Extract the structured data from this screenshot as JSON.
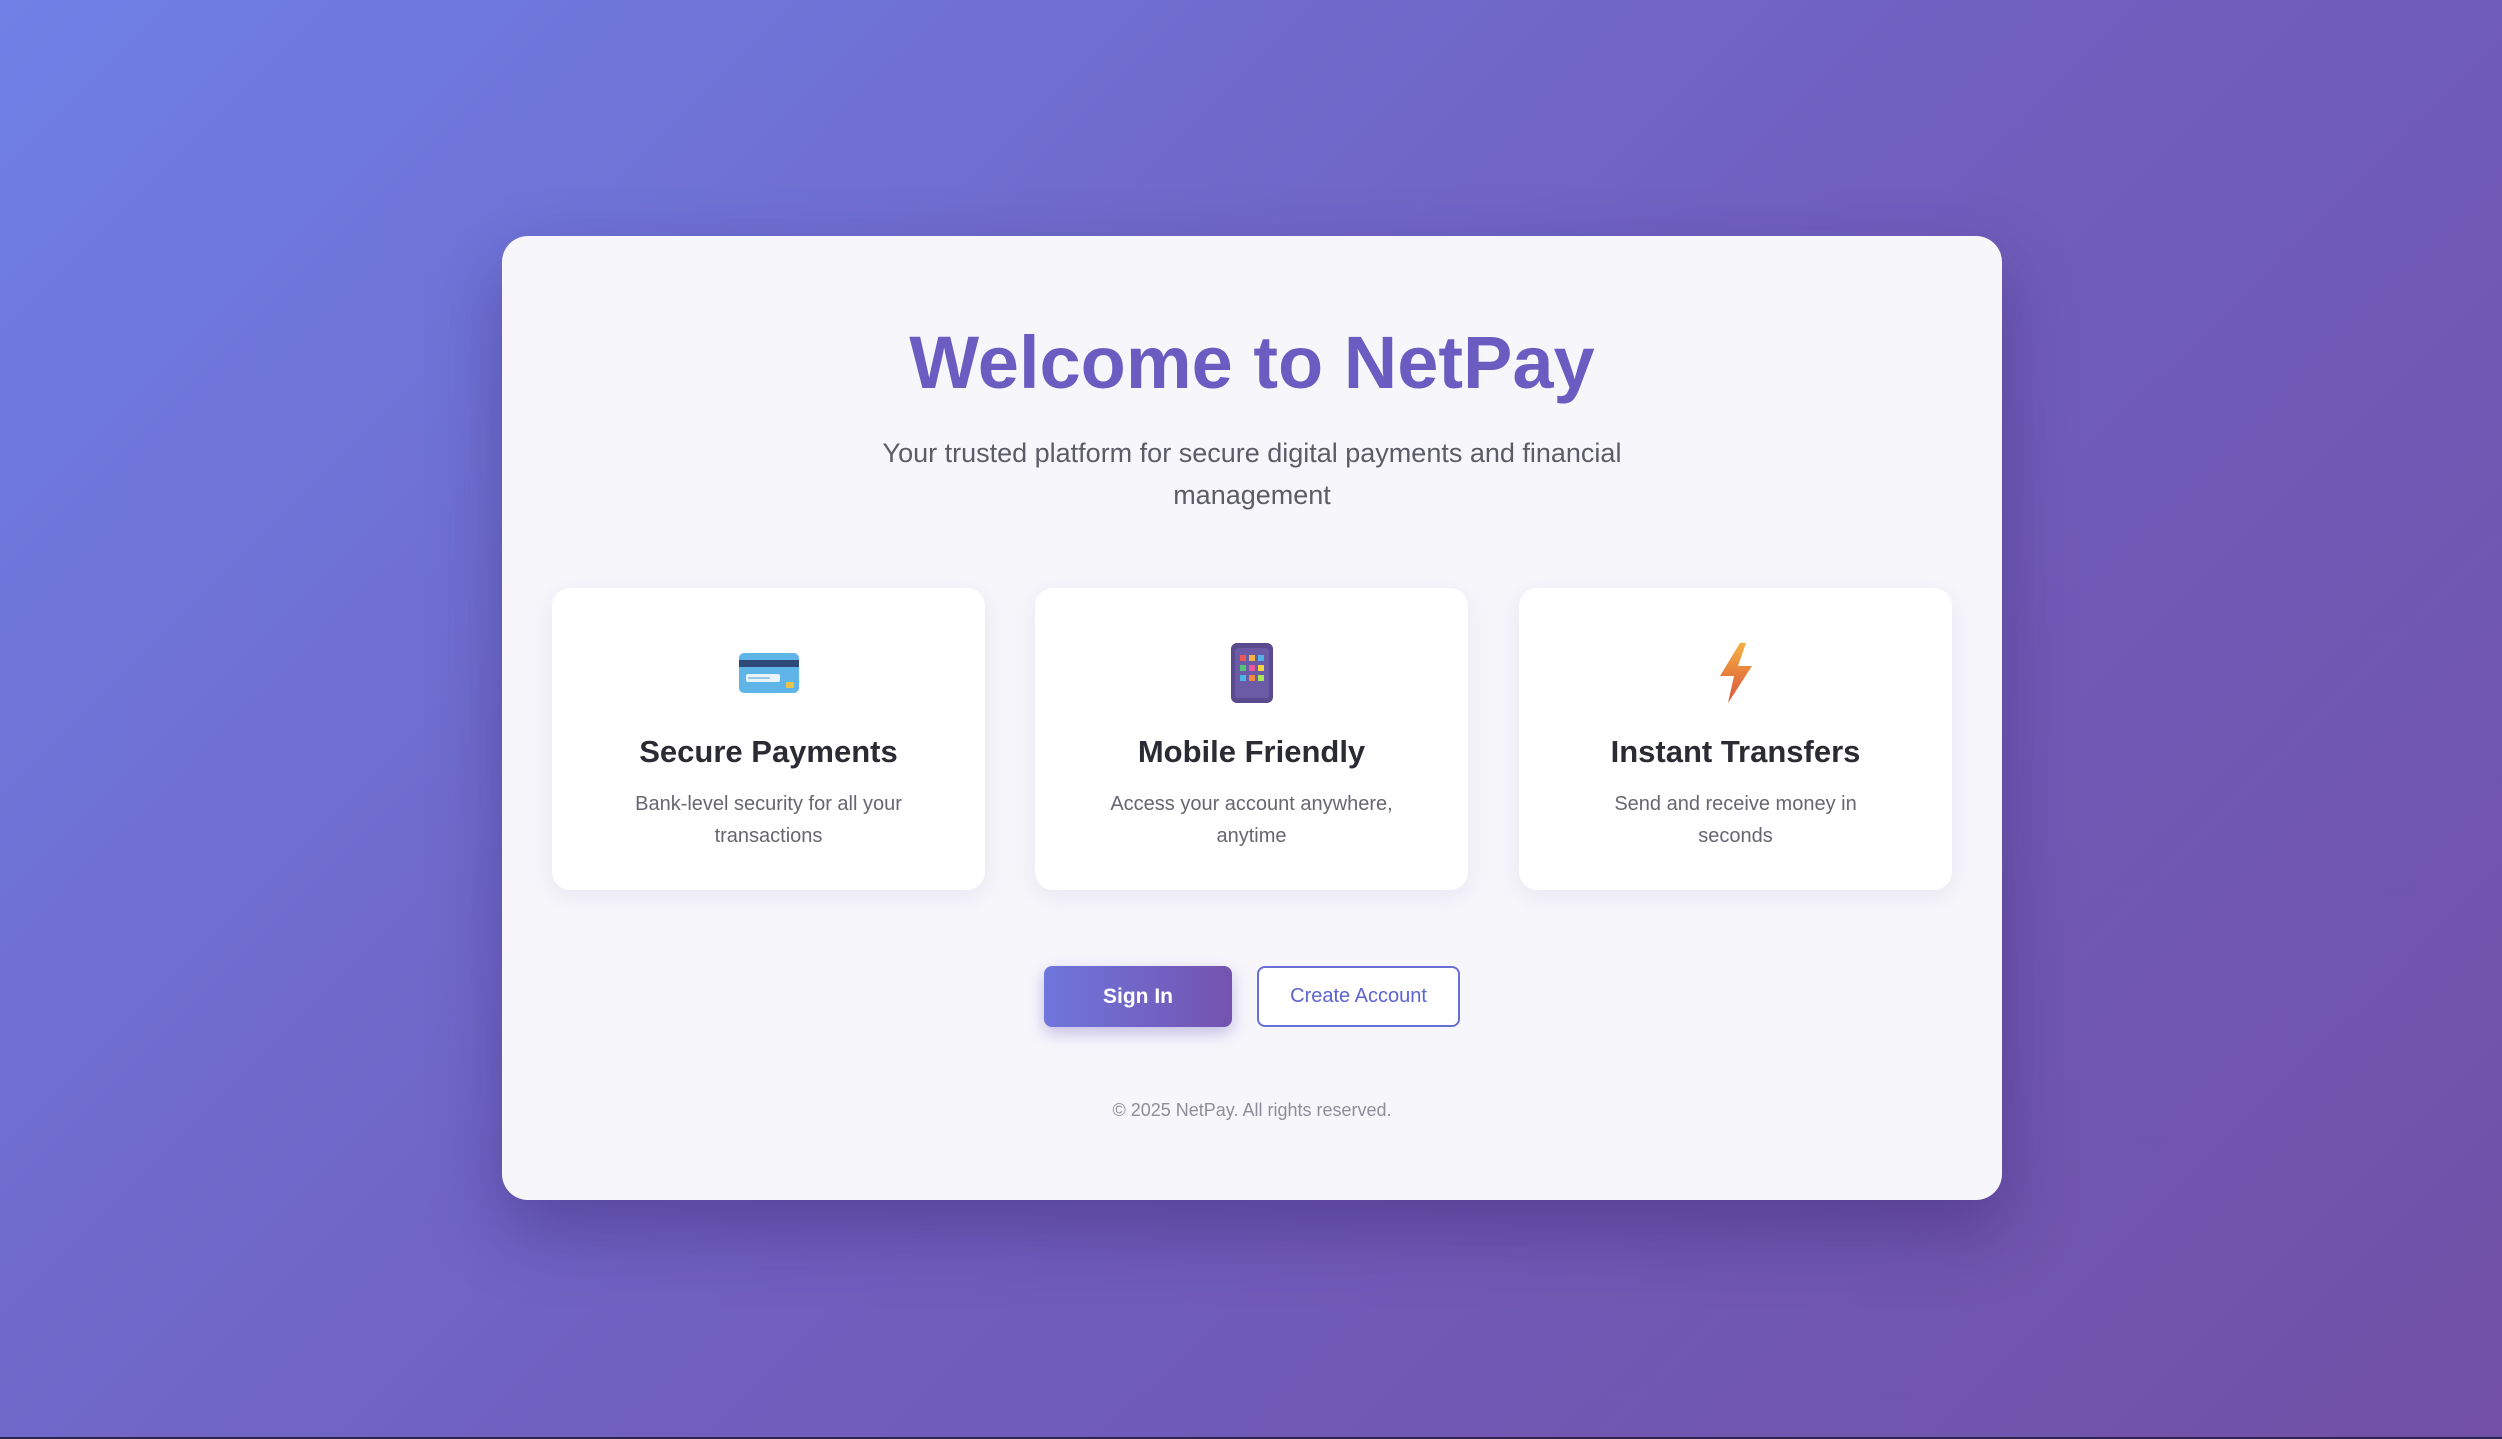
{
  "hero": {
    "title": "Welcome to NetPay",
    "subtitle": "Your trusted platform for secure digital payments and financial management"
  },
  "features": [
    {
      "icon": "credit-card-icon",
      "title": "Secure Payments",
      "description": "Bank-level security for all your transactions"
    },
    {
      "icon": "mobile-phone-icon",
      "title": "Mobile Friendly",
      "description": "Access your account anywhere, anytime"
    },
    {
      "icon": "lightning-icon",
      "title": "Instant Transfers",
      "description": "Send and receive money in seconds"
    }
  ],
  "actions": {
    "sign_in_label": "Sign In",
    "create_account_label": "Create Account"
  },
  "footer": {
    "copyright": "© 2025 NetPay. All rights reserved."
  },
  "colors": {
    "accent": "#6a5cc0",
    "button_start": "#6f76dc",
    "button_end": "#7453b0",
    "background_start": "#6f80e6",
    "background_end": "#7150a6"
  }
}
